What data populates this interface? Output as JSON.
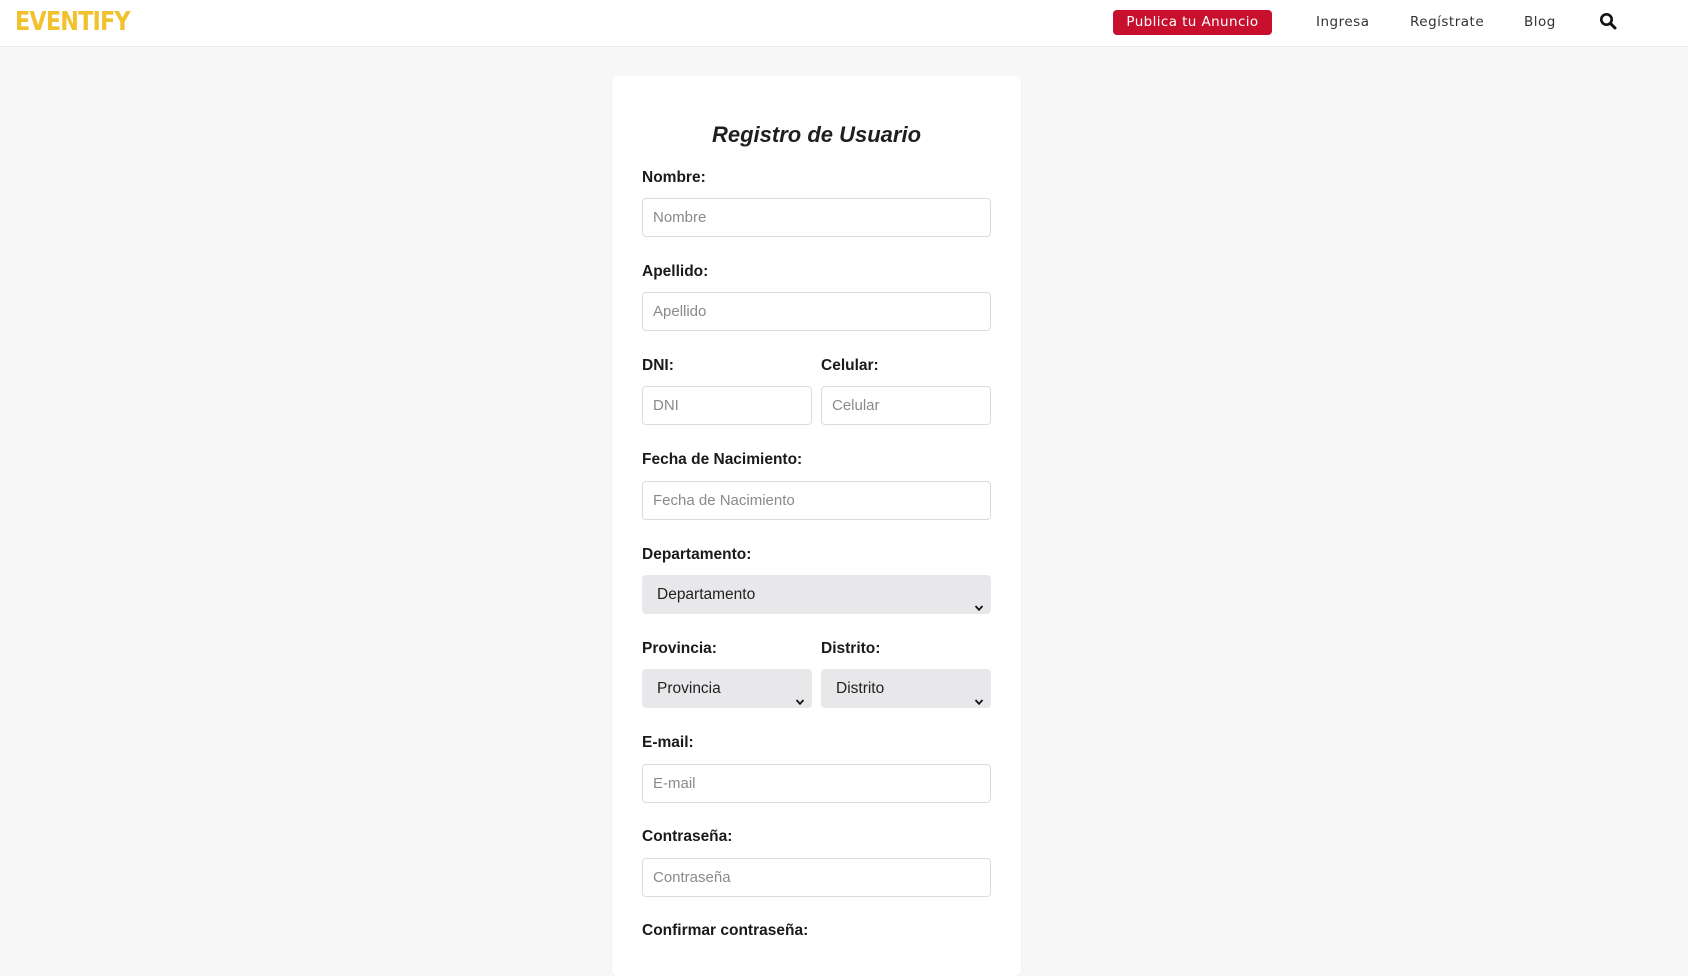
{
  "header": {
    "logo": "EVENTIFY",
    "publish_label": "Publica tu Anuncio",
    "nav": {
      "login": "Ingresa",
      "register": "Regístrate",
      "blog": "Blog"
    },
    "search_icon": "search-icon"
  },
  "colors": {
    "brand_yellow": "#f2c12e",
    "accent_red": "#c8102e",
    "page_bg": "#f7f7f8",
    "select_bg": "#e8e8eb"
  },
  "form": {
    "title": "Registro de Usuario",
    "nombre": {
      "label": "Nombre:",
      "placeholder": "Nombre"
    },
    "apellido": {
      "label": "Apellido:",
      "placeholder": "Apellido"
    },
    "dni": {
      "label": "DNI:",
      "placeholder": "DNI"
    },
    "celular": {
      "label": "Celular:",
      "placeholder": "Celular"
    },
    "fecha": {
      "label": "Fecha de Nacimiento:",
      "placeholder": "Fecha de Nacimiento"
    },
    "departamento": {
      "label": "Departamento:",
      "selected": "Departamento"
    },
    "provincia": {
      "label": "Provincia:",
      "selected": "Provincia"
    },
    "distrito": {
      "label": "Distrito:",
      "selected": "Distrito"
    },
    "email": {
      "label": "E-mail:",
      "placeholder": "E-mail"
    },
    "password": {
      "label": "Contraseña:",
      "placeholder": "Contraseña"
    },
    "confirm": {
      "label": "Confirmar contraseña:"
    }
  }
}
